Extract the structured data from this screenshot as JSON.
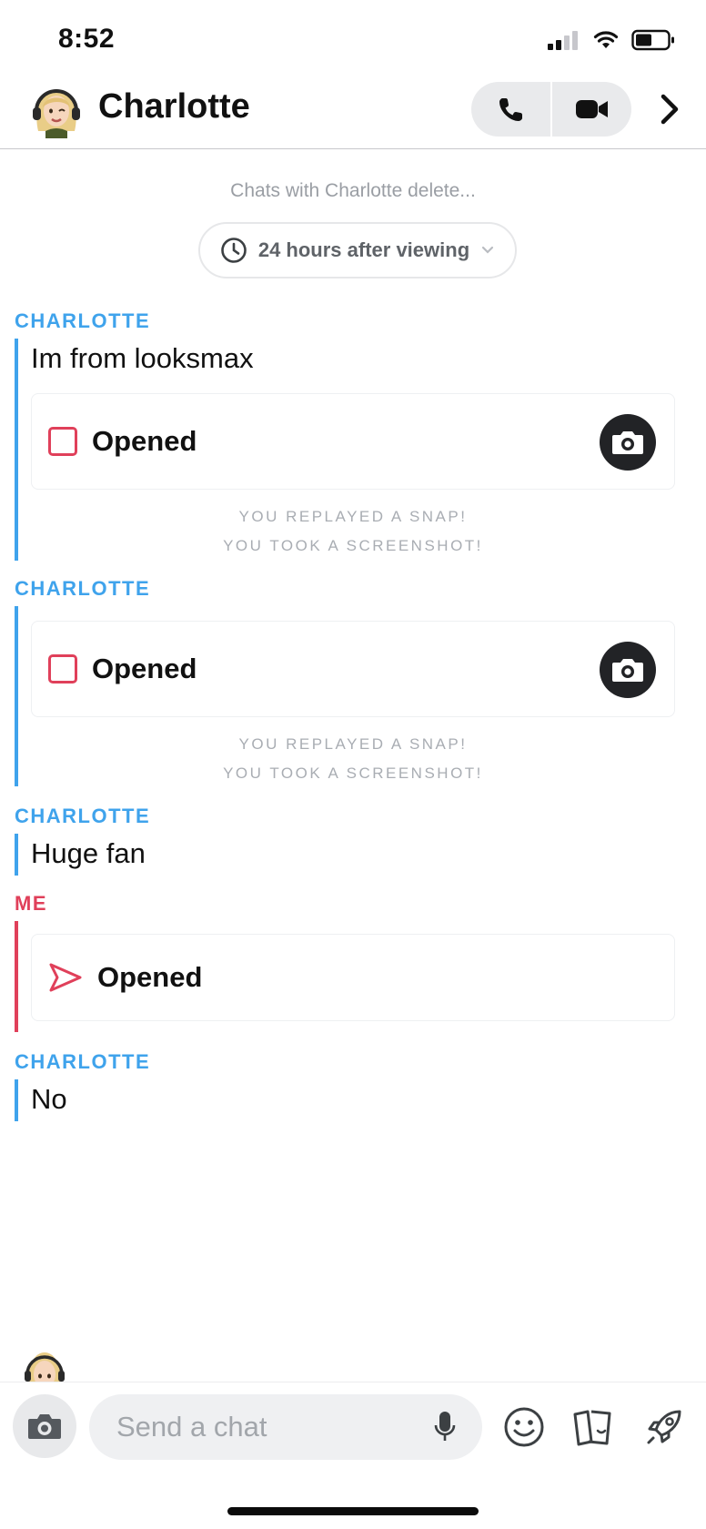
{
  "status_bar": {
    "time": "8:52"
  },
  "header": {
    "contact_name": "Charlotte"
  },
  "retention": {
    "notice": "Chats with Charlotte delete...",
    "option": "24 hours after viewing"
  },
  "messages": [
    {
      "sender": "CHARLOTTE",
      "text": "Im from looksmax"
    },
    {
      "snap_label": "Opened",
      "notes": [
        "YOU REPLAYED A SNAP!",
        "YOU TOOK A SCREENSHOT!"
      ]
    },
    {
      "sender": "CHARLOTTE",
      "snap_label": "Opened",
      "notes": [
        "YOU REPLAYED A SNAP!",
        "YOU TOOK A SCREENSHOT!"
      ]
    },
    {
      "sender": "CHARLOTTE",
      "text": "Huge fan"
    },
    {
      "sender": "ME",
      "snap_label": "Opened"
    },
    {
      "sender": "CHARLOTTE",
      "text": "No"
    }
  ],
  "composer": {
    "placeholder": "Send a chat"
  },
  "colors": {
    "friend_accent": "#3fa3ec",
    "me_accent": "#e0405a",
    "snap_icon_dark": "#222326"
  },
  "icons": {
    "phone": "phone-icon",
    "video": "video-camera-icon",
    "chevron": "chevron-right-icon",
    "clock": "clock-icon",
    "camera": "camera-icon",
    "mic": "microphone-icon",
    "emoji": "smiley-face-icon",
    "stickers": "sticker-cards-icon",
    "rocket": "rocket-icon",
    "sent": "sent-arrow-icon",
    "opened_snap": "opened-snap-square-icon"
  }
}
